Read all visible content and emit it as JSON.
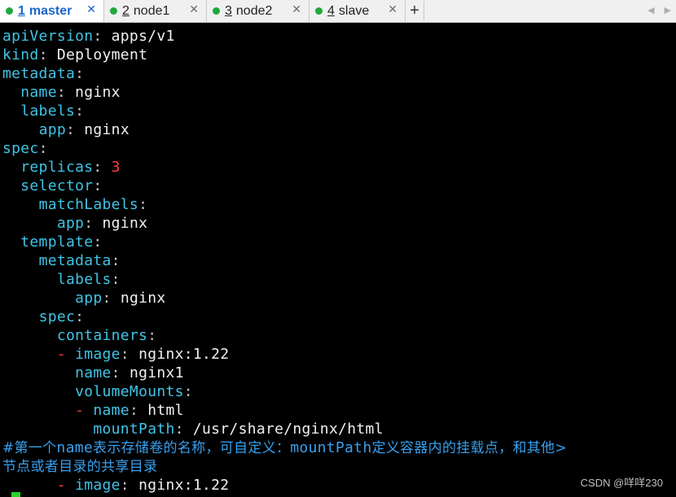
{
  "tabs": [
    {
      "num": "1",
      "name": "master",
      "active": true
    },
    {
      "num": "2",
      "name": "node1",
      "active": false
    },
    {
      "num": "3",
      "name": "node2",
      "active": false
    },
    {
      "num": "4",
      "name": "slave",
      "active": false
    }
  ],
  "tab_close_glyph": "✕",
  "new_tab_glyph": "+",
  "scroll_glyphs": {
    "left": "◀",
    "right": "▶"
  },
  "terminal": {
    "lines": [
      {
        "k": "apiVersion",
        "v": "apps/v1"
      },
      {
        "k": "kind",
        "v": "Deployment"
      },
      {
        "k": "metadata"
      },
      {
        "k": "name",
        "v": "nginx"
      },
      {
        "k": "labels"
      },
      {
        "k": "app",
        "v": "nginx"
      },
      {
        "k": "spec"
      },
      {
        "k": "replicas",
        "v": "3"
      },
      {
        "k": "selector"
      },
      {
        "k": "matchLabels"
      },
      {
        "k": "app",
        "v": "nginx"
      },
      {
        "k": "template"
      },
      {
        "k": "metadata"
      },
      {
        "k": "labels"
      },
      {
        "k": "app",
        "v": "nginx"
      },
      {
        "k": "spec"
      },
      {
        "k": "containers"
      },
      {
        "dash": "-",
        "k": "image",
        "v": "nginx:1.22"
      },
      {
        "k": "name",
        "v": "nginx1"
      },
      {
        "k": "volumeMounts"
      },
      {
        "dash": "-",
        "k": "name",
        "v": "html"
      },
      {
        "k": "mountPath",
        "v": "/usr/share/nginx/html"
      },
      {
        "comment_parts": [
          "#第一个",
          "name",
          "表示存储卷的名称，可自定义：",
          "mountPath",
          "定义容器内的挂载点，和其他>"
        ]
      },
      {
        "comment": "节点或者目录的共享目录"
      },
      {
        "dash": "-",
        "k": "image",
        "v": "nginx:1.22"
      }
    ]
  },
  "watermark": "CSDN @咩咩230",
  "colors": {
    "key": "#3fc4e6",
    "value": "#f0f0f0",
    "number": "#ff3b3b",
    "comment": "#37a0ee",
    "cursor": "#2ad42a",
    "active_tab_text": "#1a66c9",
    "tab_dot": "#1ea93c"
  }
}
